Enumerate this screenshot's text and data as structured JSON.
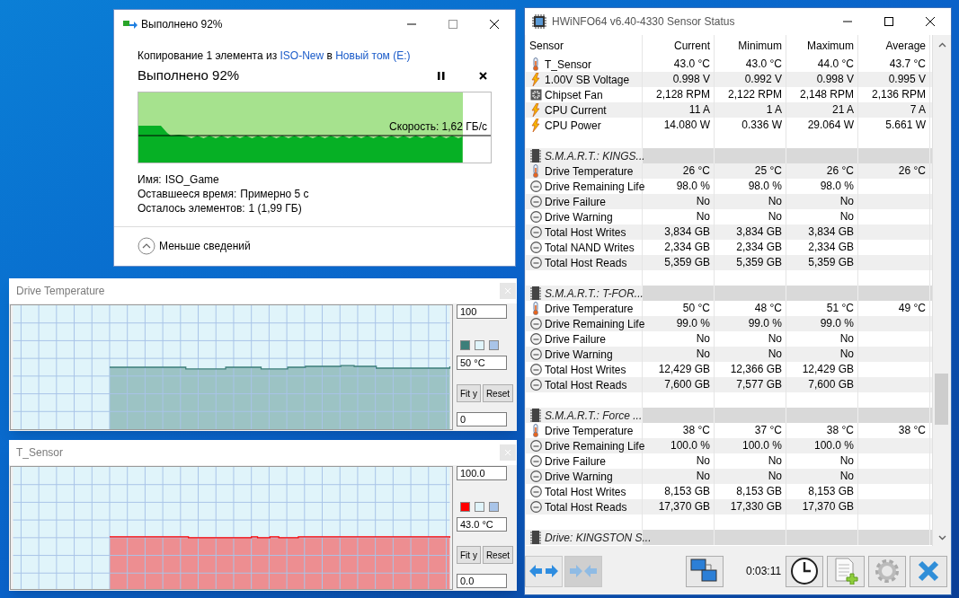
{
  "copy_dialog": {
    "title": "Выполнено 92%",
    "description": [
      {
        "kind": "text",
        "text": "Копирование 1 элемента из "
      },
      {
        "kind": "link",
        "text": "ISO-New"
      },
      {
        "kind": "text",
        "text": " в "
      },
      {
        "kind": "link",
        "text": "Новый том (E:)"
      }
    ],
    "heading": "Выполнено 92%",
    "progress": {
      "level": 0.92,
      "speed": "Скорость: 1,62 ГБ/с"
    },
    "details": [
      {
        "label": "Имя:",
        "value": "ISO_Game"
      },
      {
        "label": "Оставшееся время:",
        "value": "Примерно 5 с"
      },
      {
        "label": "Осталось элементов:",
        "value": "1 (1,99 ГБ)"
      }
    ],
    "toggle": "Меньше сведений"
  },
  "graphs": [
    {
      "title": "Drive Temperature",
      "max": "100",
      "current": "50 °C",
      "min": "0",
      "buttons": [
        "Fit y",
        "Reset"
      ],
      "swatches": [
        {
          "color": "#3d7f7a"
        },
        {
          "color": "#e0f4fa"
        },
        {
          "color": "#a9c4e8"
        }
      ]
    },
    {
      "title": "T_Sensor",
      "max": "100.0",
      "current": "43.0 °C",
      "min": "0.0",
      "buttons": [
        "Fit y",
        "Reset"
      ],
      "swatches": [
        {
          "color": "#ff0000"
        },
        {
          "color": "#e0f4fa"
        },
        {
          "color": "#a9c4e8"
        }
      ]
    }
  ],
  "hwinfo": {
    "title": "HWiNFO64 v6.40-4330 Sensor Status",
    "columns": [
      "Sensor",
      "Current",
      "Minimum",
      "Maximum",
      "Average"
    ],
    "rows": [
      {
        "kind": "temperature",
        "name": "T_Sensor",
        "current": "43.0 °C",
        "minimum": "43.0 °C",
        "maximum": "44.0 °C",
        "average": "43.7 °C"
      },
      {
        "kind": "power",
        "name": "1.00V SB Voltage",
        "current": "0.998 V",
        "minimum": "0.992 V",
        "maximum": "0.998 V",
        "average": "0.995 V"
      },
      {
        "kind": "fan",
        "name": "Chipset Fan",
        "current": "2,128 RPM",
        "minimum": "2,122 RPM",
        "maximum": "2,148 RPM",
        "average": "2,136 RPM"
      },
      {
        "kind": "power",
        "name": "CPU Current",
        "current": "11 A",
        "minimum": "1 A",
        "maximum": "21 A",
        "average": "7 A"
      },
      {
        "kind": "power",
        "name": "CPU Power",
        "current": "14.080 W",
        "minimum": "0.336 W",
        "maximum": "29.064 W",
        "average": "5.661 W"
      },
      {
        "kind": "spacer"
      },
      {
        "kind": "group",
        "name": "S.M.A.R.T.: KINGS..."
      },
      {
        "kind": "temperature",
        "name": "Drive Temperature",
        "current": "26 °C",
        "minimum": "25 °C",
        "maximum": "26 °C",
        "average": "26 °C"
      },
      {
        "kind": "drive",
        "name": "Drive Remaining Life",
        "current": "98.0 %",
        "minimum": "98.0 %",
        "maximum": "98.0 %"
      },
      {
        "kind": "drive",
        "name": "Drive Failure",
        "current": "No",
        "minimum": "No",
        "maximum": "No"
      },
      {
        "kind": "drive",
        "name": "Drive Warning",
        "current": "No",
        "minimum": "No",
        "maximum": "No"
      },
      {
        "kind": "drive",
        "name": "Total Host Writes",
        "current": "3,834 GB",
        "minimum": "3,834 GB",
        "maximum": "3,834 GB"
      },
      {
        "kind": "drive",
        "name": "Total NAND Writes",
        "current": "2,334 GB",
        "minimum": "2,334 GB",
        "maximum": "2,334 GB"
      },
      {
        "kind": "drive",
        "name": "Total Host Reads",
        "current": "5,359 GB",
        "minimum": "5,359 GB",
        "maximum": "5,359 GB"
      },
      {
        "kind": "spacer"
      },
      {
        "kind": "group",
        "name": "S.M.A.R.T.: T-FOR..."
      },
      {
        "kind": "temperature",
        "name": "Drive Temperature",
        "current": "50 °C",
        "minimum": "48 °C",
        "maximum": "51 °C",
        "average": "49 °C"
      },
      {
        "kind": "drive",
        "name": "Drive Remaining Life",
        "current": "99.0 %",
        "minimum": "99.0 %",
        "maximum": "99.0 %"
      },
      {
        "kind": "drive",
        "name": "Drive Failure",
        "current": "No",
        "minimum": "No",
        "maximum": "No"
      },
      {
        "kind": "drive",
        "name": "Drive Warning",
        "current": "No",
        "minimum": "No",
        "maximum": "No"
      },
      {
        "kind": "drive",
        "name": "Total Host Writes",
        "current": "12,429 GB",
        "minimum": "12,366 GB",
        "maximum": "12,429 GB"
      },
      {
        "kind": "drive",
        "name": "Total Host Reads",
        "current": "7,600 GB",
        "minimum": "7,577 GB",
        "maximum": "7,600 GB"
      },
      {
        "kind": "spacer"
      },
      {
        "kind": "group",
        "name": "S.M.A.R.T.: Force ..."
      },
      {
        "kind": "temperature",
        "name": "Drive Temperature",
        "current": "38 °C",
        "minimum": "37 °C",
        "maximum": "38 °C",
        "average": "38 °C"
      },
      {
        "kind": "drive",
        "name": "Drive Remaining Life",
        "current": "100.0 %",
        "minimum": "100.0 %",
        "maximum": "100.0 %"
      },
      {
        "kind": "drive",
        "name": "Drive Failure",
        "current": "No",
        "minimum": "No",
        "maximum": "No"
      },
      {
        "kind": "drive",
        "name": "Drive Warning",
        "current": "No",
        "minimum": "No",
        "maximum": "No"
      },
      {
        "kind": "drive",
        "name": "Total Host Writes",
        "current": "8,153 GB",
        "minimum": "8,153 GB",
        "maximum": "8,153 GB"
      },
      {
        "kind": "drive",
        "name": "Total Host Reads",
        "current": "17,370 GB",
        "minimum": "17,330 GB",
        "maximum": "17,370 GB"
      },
      {
        "kind": "spacer"
      },
      {
        "kind": "group",
        "name": "Drive: KINGSTON S..."
      }
    ],
    "timer": "0:03:11"
  }
}
